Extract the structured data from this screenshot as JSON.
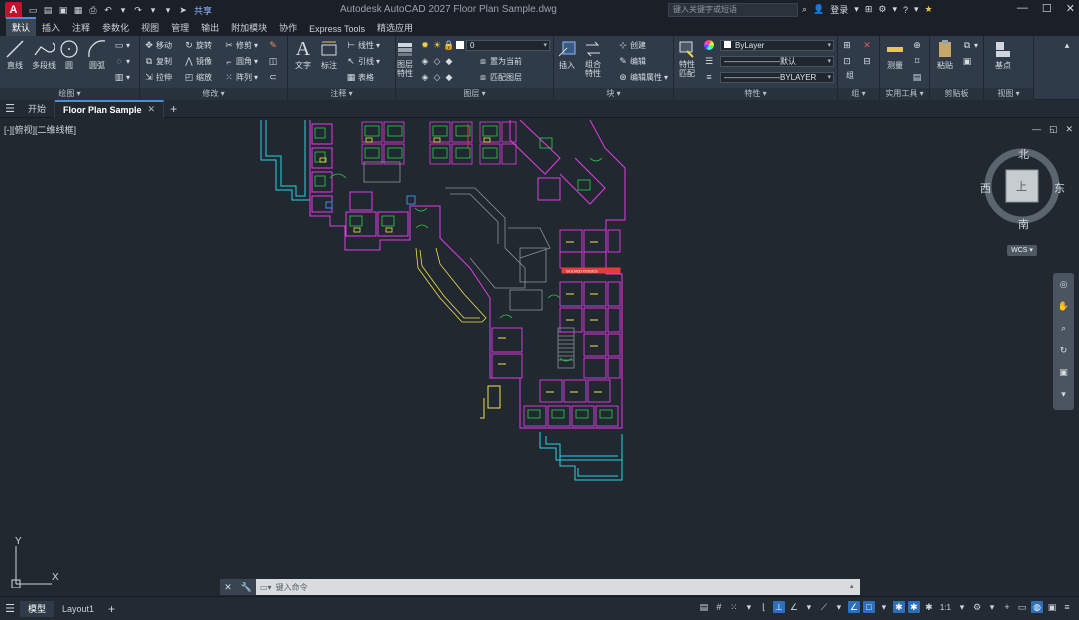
{
  "app": {
    "logo_letter": "A",
    "window_title": "Autodesk AutoCAD 2027    Floor Plan Sample.dwg",
    "share_label": "共享",
    "search_placeholder": "键入关键字或短语",
    "user_label": "登录",
    "accent_color": "#c8102e"
  },
  "ribbon_tabs": [
    "默认",
    "插入",
    "注释",
    "参数化",
    "视图",
    "管理",
    "输出",
    "附加模块",
    "协作",
    "Express Tools",
    "精选应用"
  ],
  "ribbon": {
    "draw": {
      "label": "绘图",
      "line": "直线",
      "polyline": "多段线",
      "circle": "圆",
      "arc": "圆弧"
    },
    "modify": {
      "label": "修改",
      "move": "移动",
      "rotate": "旋转",
      "trim": "修剪",
      "copy": "复制",
      "mirror": "镜像",
      "fillet": "圆角",
      "stretch": "拉伸",
      "scale": "缩放",
      "array": "阵列"
    },
    "annotation": {
      "label": "注释",
      "text": "文字",
      "dimension": "标注",
      "linear": "线性",
      "leader": "引线",
      "table": "表格"
    },
    "layers": {
      "label": "图层",
      "properties": "图层\n特性",
      "layer_value": "0",
      "make_current": "置为当前",
      "match_layer": "匹配图层"
    },
    "block": {
      "label": "块",
      "insert": "插入",
      "create": "创建",
      "edit": "编辑",
      "edit_attributes": "编辑属性"
    },
    "properties": {
      "label": "特性",
      "match": "特性\n匹配",
      "color_value": "ByLayer",
      "linetype_value": "默认",
      "lineweight_value": "BYLAYER"
    },
    "groups": {
      "label": "组",
      "group": "组"
    },
    "utilities": {
      "label": "实用工具",
      "measure": "测量"
    },
    "clipboard": {
      "label": "剪贴板",
      "paste": "粘贴"
    },
    "view": {
      "label": "视图",
      "base": "基点"
    },
    "combine_label": "组合\n特性"
  },
  "file_tabs": {
    "start": "开始",
    "active": "Floor Plan Sample"
  },
  "viewport": {
    "label": "[-][俯视][二维线框]",
    "compass": {
      "north": "北",
      "south": "南",
      "east": "东",
      "west": "西",
      "top": "上"
    },
    "wcs": "WCS",
    "ucs_y": "Y",
    "ucs_x": "X"
  },
  "plan_title": "SOLVED ISSUES",
  "command": {
    "placeholder": "键入命令"
  },
  "status": {
    "model_tab": "模型",
    "layout_tab": "Layout1",
    "scale": "1:1"
  }
}
